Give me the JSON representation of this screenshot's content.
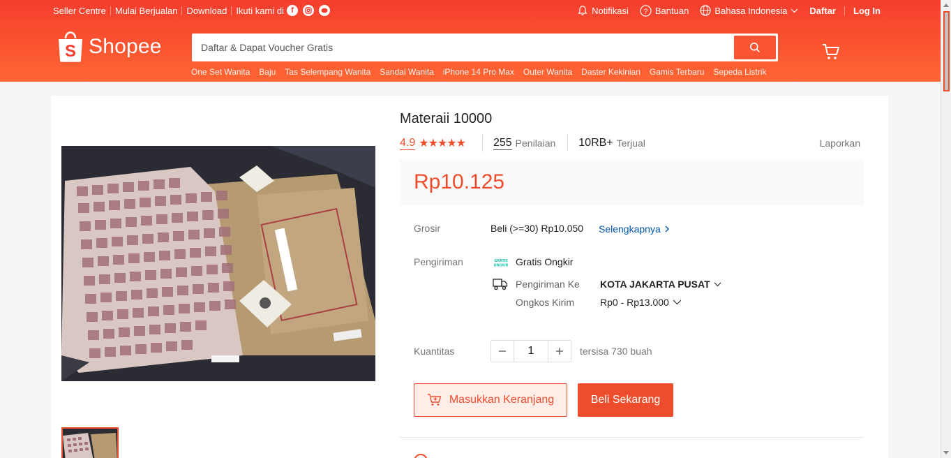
{
  "topbar": {
    "links": [
      "Seller Centre",
      "Mulai Berjualan",
      "Download",
      "Ikuti kami di"
    ],
    "social_icons": [
      "facebook-icon",
      "instagram-icon",
      "line-icon"
    ],
    "notifications": "Notifikasi",
    "help": "Bantuan",
    "language": "Bahasa Indonesia",
    "register": "Daftar",
    "login": "Log In"
  },
  "brand": {
    "name": "Shopee",
    "accent_color": "#ee4d2d"
  },
  "search": {
    "placeholder": "Daftar & Dapat Voucher Gratis",
    "suggestions": [
      "One Set Wanita",
      "Baju",
      "Tas Selempang Wanita",
      "Sandal Wanita",
      "iPhone 14 Pro Max",
      "Outer Wanita",
      "Daster Kekinian",
      "Gamis Terbaru",
      "Sepeda Listrik"
    ]
  },
  "product": {
    "title": "Materaii 10000",
    "rating": "4.9",
    "star_count": 5,
    "reviews_count": "255",
    "reviews_label": "Penilaian",
    "sold_count": "10RB+",
    "sold_label": "Terjual",
    "report": "Laporkan",
    "price": "Rp10.125",
    "wholesale_label": "Grosir",
    "wholesale_value": "Beli (>=30) Rp10.050",
    "wholesale_link": "Selengkapnya",
    "shipping_label": "Pengiriman",
    "free_shipping_badge": "GRATIS ONGKIR",
    "free_shipping": "Gratis Ongkir",
    "ship_to_label": "Pengiriman Ke",
    "ship_to_value": "KOTA JAKARTA PUSAT",
    "ship_cost_label": "Ongkos Kirim",
    "ship_cost_value": "Rp0 - Rp13.000",
    "quantity_label": "Kuantitas",
    "quantity_value": "1",
    "stock": "tersisa 730 buah",
    "add_to_cart": "Masukkan Keranjang",
    "buy_now": "Beli Sekarang"
  }
}
